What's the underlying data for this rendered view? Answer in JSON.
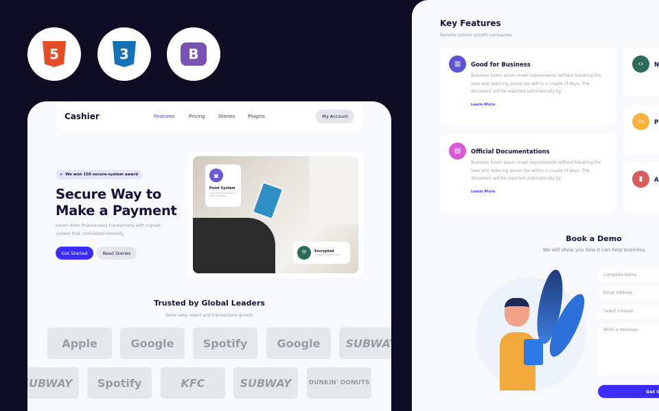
{
  "tech_logos": [
    {
      "name": "html5-icon",
      "label": "5",
      "color": "#e44d26"
    },
    {
      "name": "css3-icon",
      "label": "3",
      "color": "#1572b6"
    },
    {
      "name": "bootstrap-icon",
      "label": "B",
      "color": "#7952b3"
    }
  ],
  "left": {
    "brand": "Cashier",
    "nav": [
      {
        "label": "Features",
        "active": true
      },
      {
        "label": "Pricing"
      },
      {
        "label": "Stories"
      },
      {
        "label": "Plugins"
      }
    ],
    "account": "My Account",
    "badge": "We won 150 secure-system award",
    "title": "Secure Way to Make a Payment",
    "lead": "Lorem dolor finance easy transactions with a great system that centralized normally.",
    "primary": "Get Started",
    "secondary": "Read Stories",
    "point": {
      "title": "Point System",
      "desc": "Get more awards and more freedom"
    },
    "enc": {
      "title": "Encrypted",
      "desc": "Shopping safety easy"
    },
    "trusted_title": "Trusted by Global Leaders",
    "trusted_sub": "Dolor easy report and transactions growth",
    "logos_row1": [
      "Apple",
      "Google",
      "Spotify",
      "Google",
      "SUBWAY"
    ],
    "logos_row2": [
      "SUBWAY",
      "Spotify",
      "KFC",
      "SUBWAY",
      "DUNKIN' DONUTS"
    ]
  },
  "right": {
    "title": "Key Features",
    "sub": "Reliable system growth companies",
    "features": [
      {
        "title": "Good for Business",
        "desc": "Business lorem ipsum meet requirements without breaking the laws and reducing ipsum tax within a couple of days. The document will be reported automatically by.",
        "link": "Learn More",
        "color": "#5b55d6"
      },
      {
        "title": "Official Documentations",
        "desc": "Business lorem ipsum meet requirements without breaking the laws and reducing ipsum tax within a couple of days. The document will be reported automatically by.",
        "link": "Learn More",
        "color": "#d85bd4"
      }
    ],
    "side_features": [
      {
        "title": "N",
        "desc": "Bu m",
        "color": "#2c6a5a"
      },
      {
        "title": "P",
        "desc": "Bu m",
        "color": "#fbb23e"
      },
      {
        "title": "A",
        "desc": "Bu m",
        "color": "#d95c5c"
      }
    ],
    "demo_title": "Book a Demo",
    "demo_sub": "We will show you how it can help business",
    "form": {
      "name": "Complete Name",
      "email": "Email Address",
      "interest": "Select interest",
      "message": "Write a message",
      "submit": "Get St"
    }
  },
  "colors": {
    "accent": "#3b2cff",
    "dark": "#0e0d24"
  }
}
